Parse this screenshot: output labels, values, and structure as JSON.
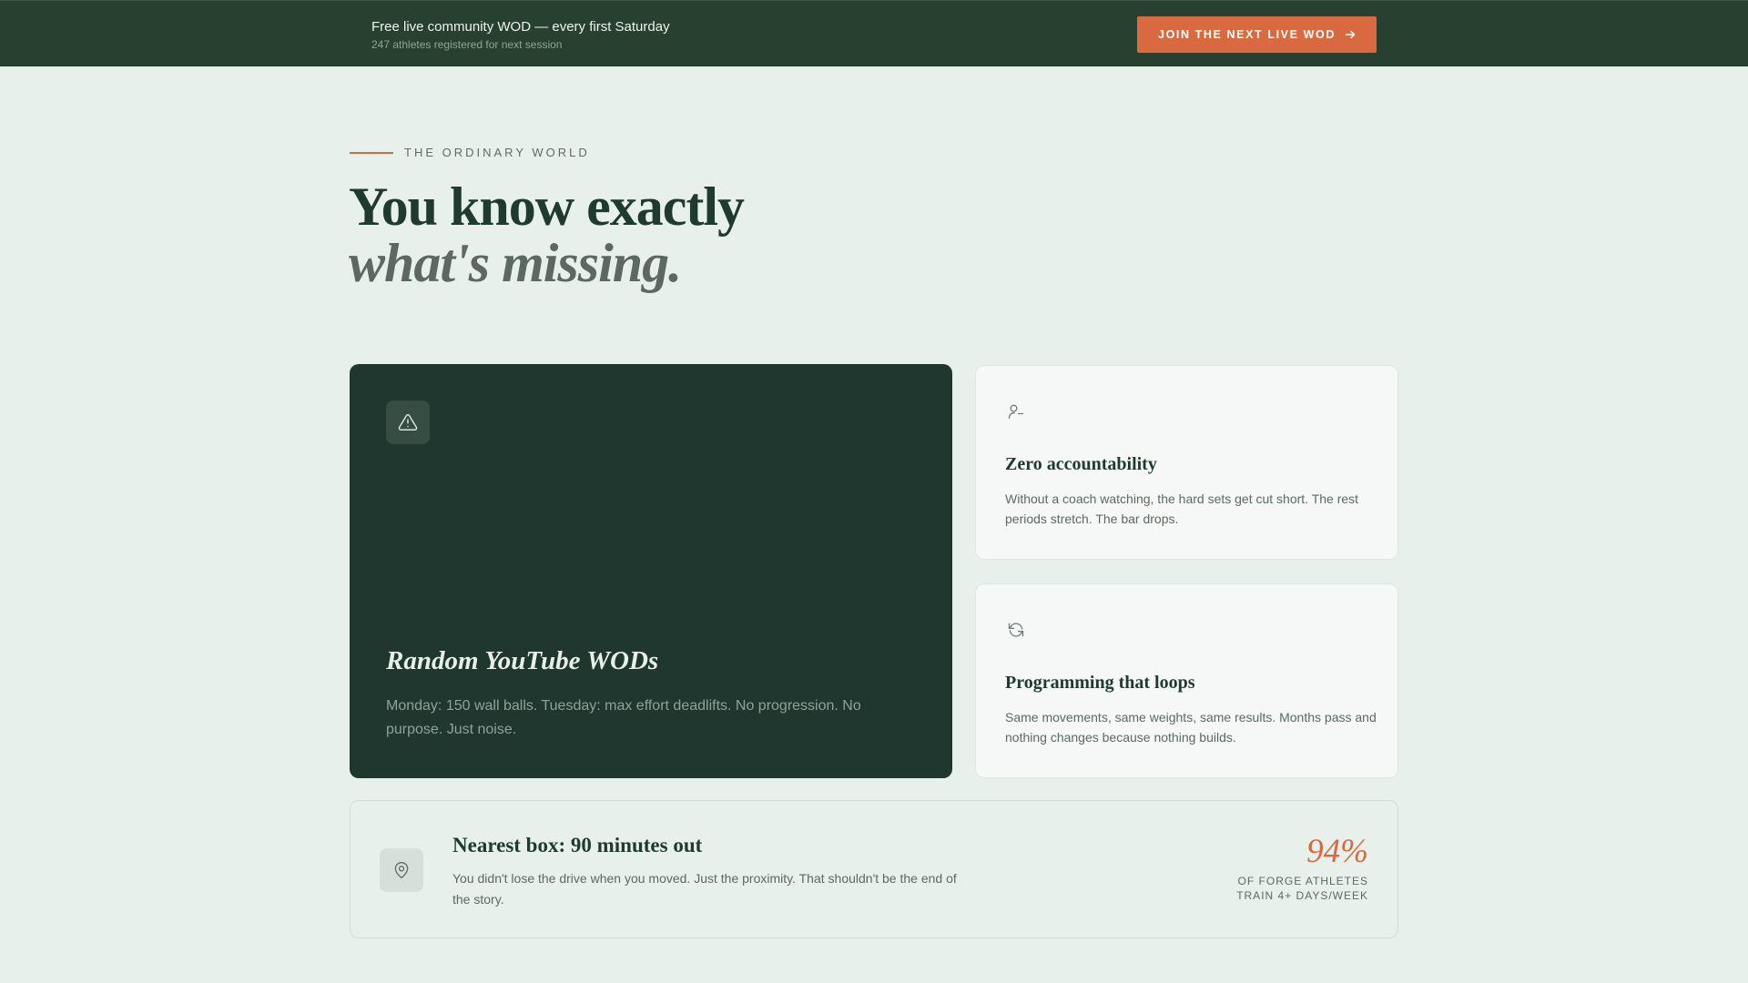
{
  "topbar": {
    "title": "Free live community WOD — every first Saturday",
    "subtitle": "247 athletes registered for next session",
    "cta_label": "JOIN THE NEXT LIVE WOD",
    "cta_icon": "arrow-right-icon"
  },
  "hero": {
    "eyebrow": "THE ORDINARY WORLD",
    "headline_line1": "You know exactly",
    "headline_line2": "what's missing."
  },
  "cards": {
    "youtube": {
      "icon": "warning-triangle-icon",
      "title": "Random YouTube WODs",
      "body": "Monday: 150 wall balls. Tuesday: max effort deadlifts. No progression. No purpose. Just noise."
    },
    "accountability": {
      "icon": "user-minus-icon",
      "title": "Zero accountability",
      "body": "Without a coach watching, the hard sets get cut short. The rest periods stretch. The bar drops."
    },
    "programming": {
      "icon": "refresh-icon",
      "title": "Programming that loops",
      "body": "Same movements, same weights, same results. Months pass and nothing changes because nothing builds."
    },
    "nearest_box": {
      "icon": "map-pin-icon",
      "title": "Nearest box: 90 minutes out",
      "body": "You didn't lose the drive when you moved. Just the proximity. That shouldn't be the end of the story.",
      "stat_value": "94%",
      "stat_label": "OF FORGE ATHLETES TRAIN 4+ DAYS/WEEK"
    }
  },
  "colors": {
    "accent": "#d96a3f",
    "dark_green": "#1f372e",
    "topbar": "#28402f",
    "page_bg": "#e8f0eb"
  }
}
